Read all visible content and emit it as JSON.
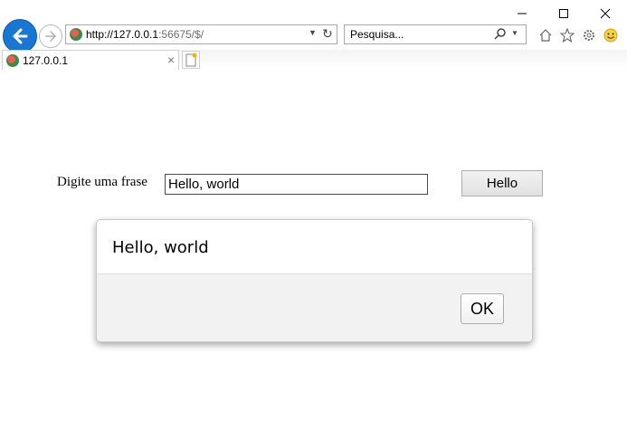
{
  "browser": {
    "address": {
      "host": "http://127.0.0.1",
      "rest": ":56675/$/"
    },
    "search_placeholder": "Pesquisa...",
    "tab_title": "127.0.0.1",
    "icons": [
      "back-arrow-icon",
      "forward-arrow-icon",
      "dropdown-icon",
      "refresh-icon",
      "search-icon",
      "home-icon",
      "favorites-star-icon",
      "settings-gear-icon",
      "smiley-icon",
      "close-tab-icon",
      "new-tab-icon"
    ],
    "accent_color": "#1976d2"
  },
  "form": {
    "label": "Digite uma frase",
    "input_value": "Hello, world",
    "button_label": "Hello"
  },
  "dialog": {
    "message": "Hello, world",
    "ok_label": "OK"
  }
}
